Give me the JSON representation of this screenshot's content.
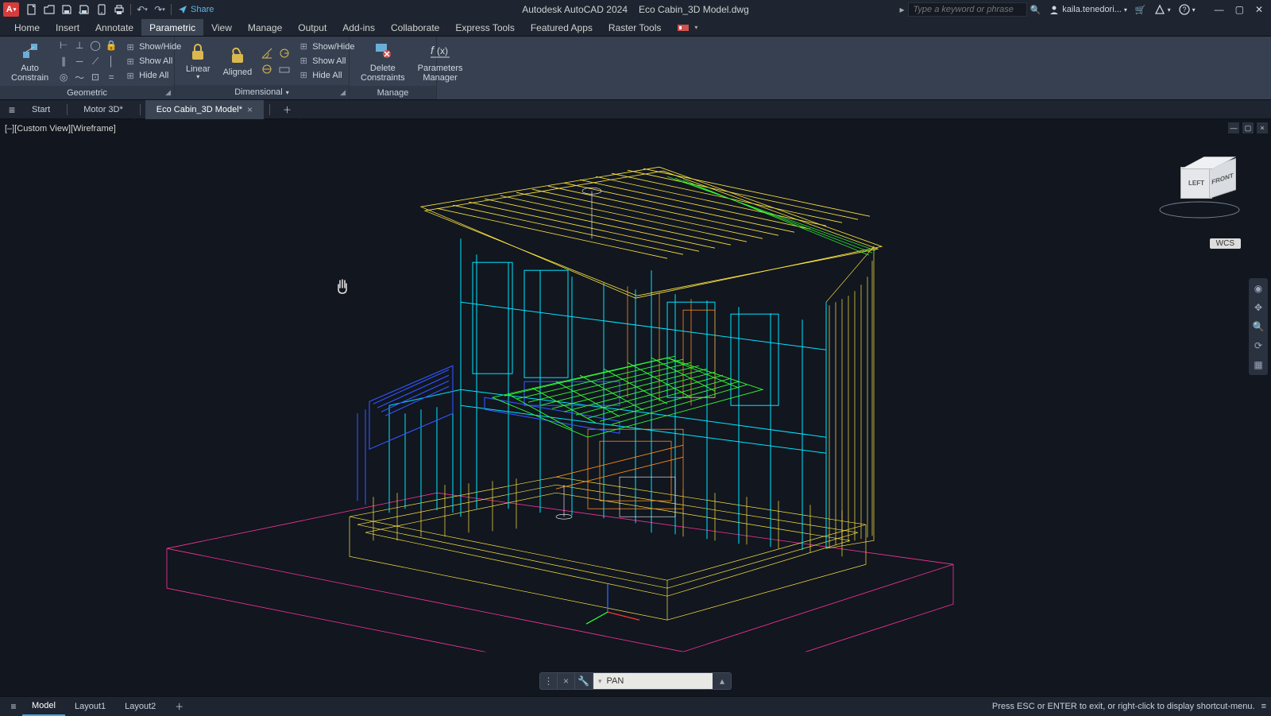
{
  "titlebar": {
    "app_letter": "A",
    "share": "Share",
    "app_name": "Autodesk AutoCAD 2024",
    "doc_name": "Eco Cabin_3D Model.dwg",
    "search_placeholder": "Type a keyword or phrase",
    "username": "kaila.tenedori..."
  },
  "menu": {
    "items": [
      "Home",
      "Insert",
      "Annotate",
      "Parametric",
      "View",
      "Manage",
      "Output",
      "Add-ins",
      "Collaborate",
      "Express Tools",
      "Featured Apps",
      "Raster Tools"
    ],
    "active_index": 3
  },
  "ribbon": {
    "geometric": {
      "auto_constrain": "Auto\nConstrain",
      "show_hide": "Show/Hide",
      "show_all": "Show All",
      "hide_all": "Hide All",
      "title": "Geometric"
    },
    "dimensional": {
      "linear": "Linear",
      "aligned": "Aligned",
      "show_hide": "Show/Hide",
      "show_all": "Show All",
      "hide_all": "Hide All",
      "title": "Dimensional"
    },
    "manage": {
      "delete": "Delete\nConstraints",
      "params": "Parameters\nManager",
      "title": "Manage"
    }
  },
  "doc_tabs": {
    "items": [
      "Start",
      "Motor 3D*",
      "Eco Cabin_3D Model*"
    ],
    "active_index": 2
  },
  "canvas": {
    "view_label": "[–][Custom View][Wireframe]",
    "wcs": "WCS",
    "viewcube": {
      "left": "LEFT",
      "front": "FRONT"
    }
  },
  "cmd": {
    "text": "PAN"
  },
  "bottom": {
    "tabs": [
      "Model",
      "Layout1",
      "Layout2"
    ],
    "active_index": 0,
    "status": "Press ESC or ENTER to exit, or right-click to display shortcut-menu."
  }
}
